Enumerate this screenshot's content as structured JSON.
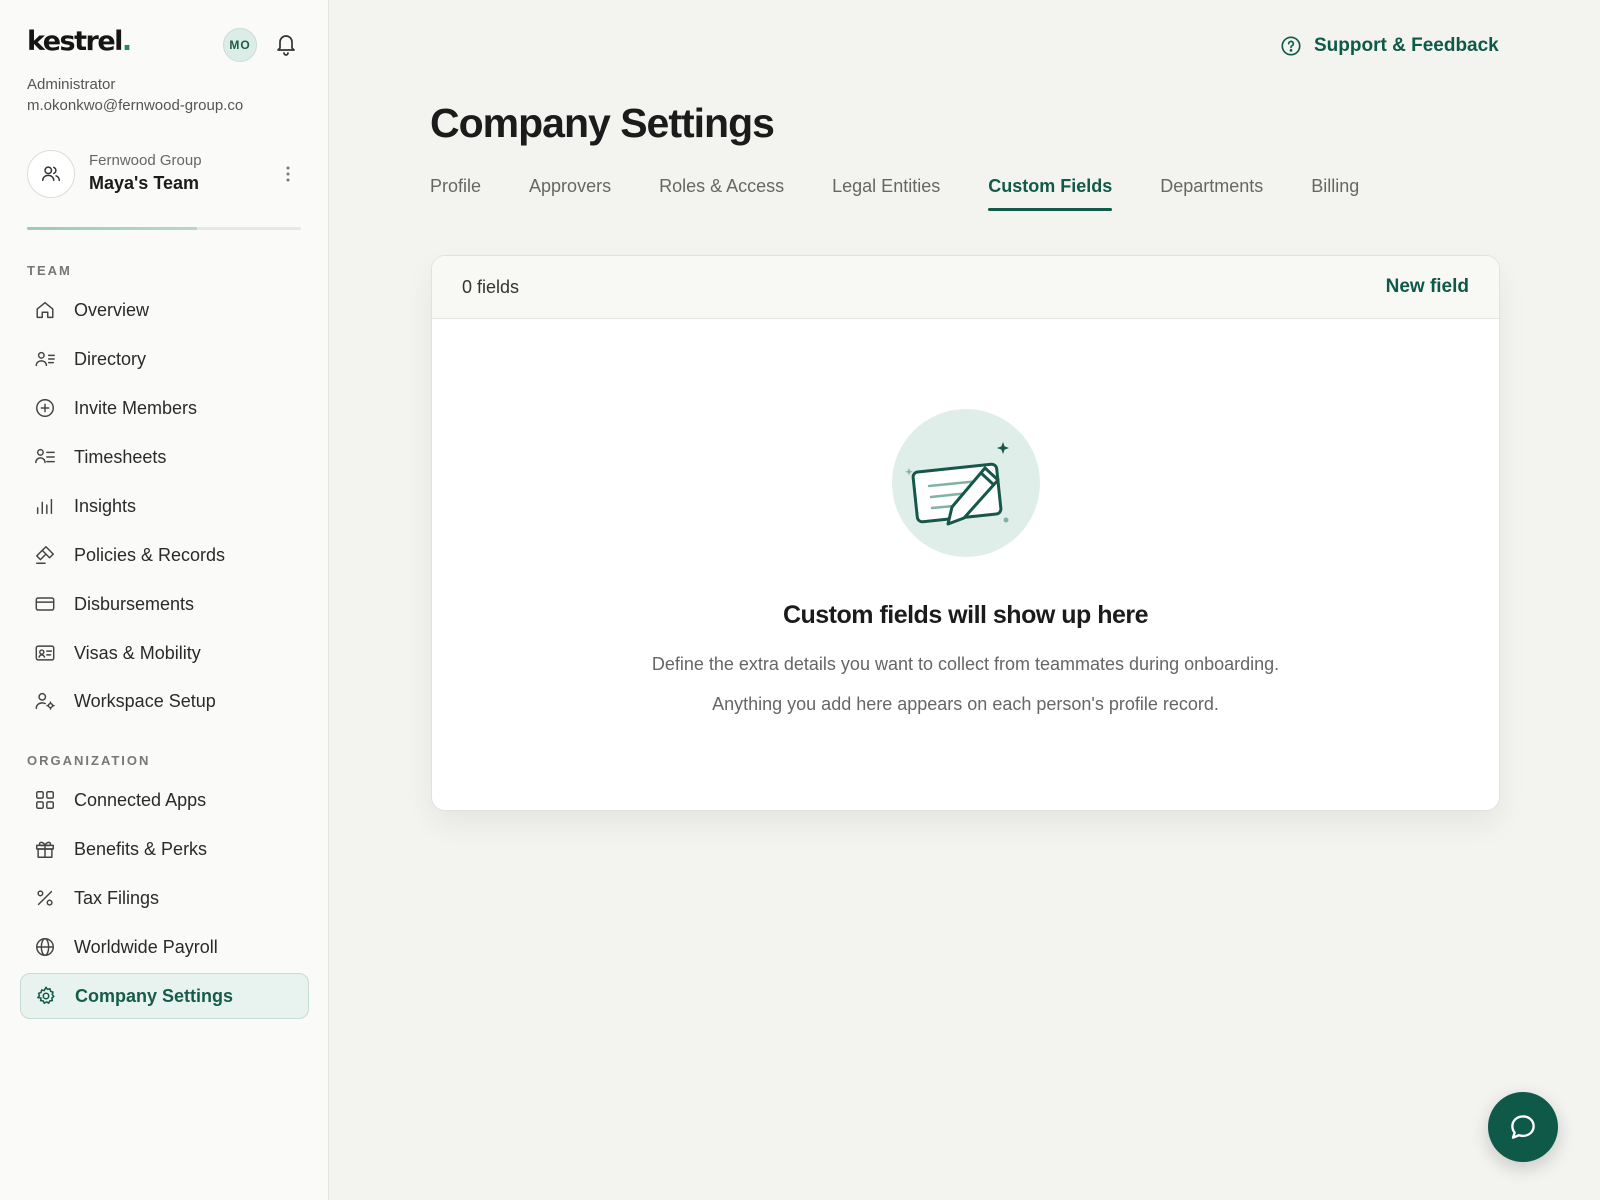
{
  "brand": {
    "logo_text": "kestrel",
    "logo_dot": "."
  },
  "user": {
    "initials": "MO",
    "role": "Administrator",
    "email": "m.okonkwo@fernwood-group.co"
  },
  "team": {
    "org": "Fernwood Group",
    "name": "Maya's Team",
    "setup_progress": 0.62
  },
  "sidebar": {
    "team_section": "TEAM",
    "team_items": [
      {
        "label": "Overview",
        "icon": "home-icon"
      },
      {
        "label": "Directory",
        "icon": "directory-icon"
      },
      {
        "label": "Invite Members",
        "icon": "plus-circle-icon"
      },
      {
        "label": "Timesheets",
        "icon": "timesheets-icon"
      },
      {
        "label": "Insights",
        "icon": "bar-chart-icon"
      },
      {
        "label": "Policies & Records",
        "icon": "gavel-icon"
      },
      {
        "label": "Disbursements",
        "icon": "card-icon"
      },
      {
        "label": "Visas & Mobility",
        "icon": "id-card-icon"
      },
      {
        "label": "Workspace Setup",
        "icon": "user-gear-icon"
      }
    ],
    "org_section": "ORGANIZATION",
    "org_items": [
      {
        "label": "Connected Apps",
        "icon": "apps-grid-icon"
      },
      {
        "label": "Benefits & Perks",
        "icon": "gift-icon"
      },
      {
        "label": "Tax Filings",
        "icon": "percent-icon"
      },
      {
        "label": "Worldwide Payroll",
        "icon": "globe-icon"
      },
      {
        "label": "Company Settings",
        "icon": "gear-icon",
        "active": true
      }
    ]
  },
  "header": {
    "support_label": "Support & Feedback"
  },
  "page": {
    "title": "Company Settings",
    "tabs": [
      {
        "label": "Profile"
      },
      {
        "label": "Approvers"
      },
      {
        "label": "Roles & Access"
      },
      {
        "label": "Legal Entities"
      },
      {
        "label": "Custom Fields",
        "active": true
      },
      {
        "label": "Departments"
      },
      {
        "label": "Billing"
      }
    ]
  },
  "custom_fields": {
    "count_label": "0 fields",
    "new_field_label": "New field",
    "empty_title": "Custom fields will show up here",
    "empty_line_1": "Define the extra details you want to collect from teammates during onboarding.",
    "empty_line_2": "Anything you add here appears on each person's profile record."
  },
  "colors": {
    "accent": "#0f5948",
    "active_bg": "#e8f2ee",
    "background": "#f3f3f0"
  }
}
